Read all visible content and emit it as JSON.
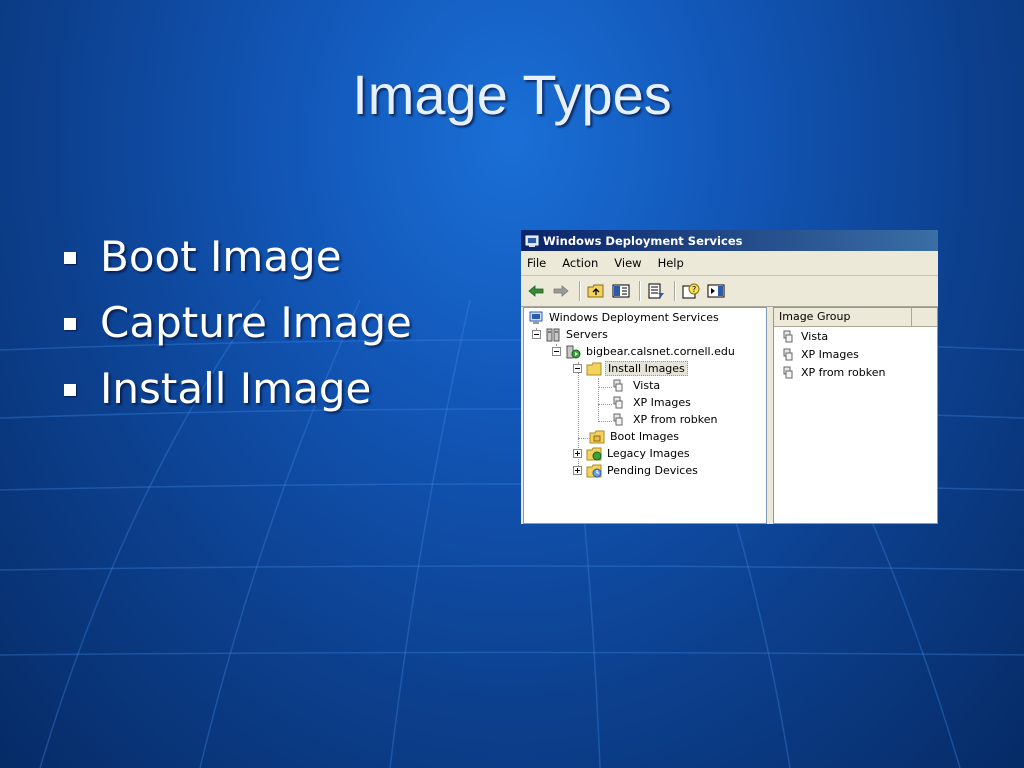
{
  "slide": {
    "title": "Image Types",
    "bullets": [
      "Boot Image",
      "Capture Image",
      "Install Image"
    ]
  },
  "window": {
    "title": "Windows Deployment Services",
    "menu": [
      "File",
      "Action",
      "View",
      "Help"
    ],
    "toolbar_icons": [
      "back-arrow-icon",
      "forward-arrow-icon",
      "up-folder-icon",
      "show-hide-tree-icon",
      "export-list-icon",
      "help-icon",
      "action-pane-icon"
    ],
    "tree": {
      "root": "Windows Deployment Services",
      "servers": "Servers",
      "server": "bigbear.calsnet.cornell.edu",
      "install_images": "Install Images",
      "groups": [
        "Vista",
        "XP Images",
        "XP from robken"
      ],
      "boot_images": "Boot Images",
      "legacy_images": "Legacy Images",
      "pending_devices": "Pending Devices"
    },
    "list": {
      "column": "Image Group",
      "items": [
        "Vista",
        "XP Images",
        "XP from robken"
      ]
    }
  },
  "colors": {
    "slide_background": "#1257b8",
    "title_bar": "#0a246a",
    "window_face": "#ece9d8"
  }
}
